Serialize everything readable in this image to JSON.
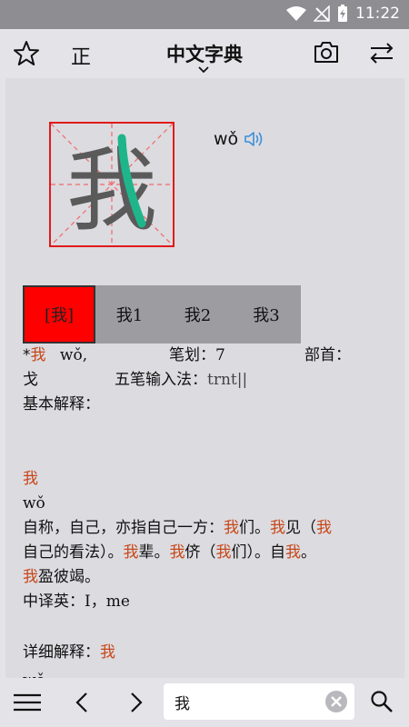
{
  "status": {
    "time": "11:22",
    "icons": [
      "wifi-icon",
      "no-signal-icon",
      "battery-charging-icon"
    ]
  },
  "topbar": {
    "zheng_label": "正",
    "title": "中文字典"
  },
  "char": {
    "glyph": "我",
    "pinyin": "wǒ"
  },
  "tabs": [
    {
      "label": "[我]"
    },
    {
      "label": "我1"
    },
    {
      "label": "我2"
    },
    {
      "label": "我3"
    }
  ],
  "entry": {
    "star": "*",
    "headword": "我",
    "pinyin": "wǒ,",
    "strokes_label": "笔划：",
    "strokes": "7",
    "radical_label": "部首：",
    "radical": "戈",
    "wubi_label": "五笔输入法：",
    "wubi": "trnt||",
    "basic_label": "基本解释："
  },
  "basic": {
    "char": "我",
    "pinyin": "wǒ",
    "line1": [
      {
        "t": "自称，自己，亦指自己一方：",
        "h": false
      },
      {
        "t": "我",
        "h": true
      },
      {
        "t": "们。",
        "h": false
      },
      {
        "t": "我",
        "h": true
      },
      {
        "t": "见（",
        "h": false
      },
      {
        "t": "我",
        "h": true
      }
    ],
    "line2": [
      {
        "t": "自己的看法）。",
        "h": false
      },
      {
        "t": "我",
        "h": true
      },
      {
        "t": "辈。",
        "h": false
      },
      {
        "t": "我",
        "h": true
      },
      {
        "t": "侪（",
        "h": false
      },
      {
        "t": "我",
        "h": true
      },
      {
        "t": "们）。自",
        "h": false
      },
      {
        "t": "我",
        "h": true
      },
      {
        "t": "。",
        "h": false
      }
    ],
    "line3": [
      {
        "t": "我",
        "h": true
      },
      {
        "t": "盈彼竭。",
        "h": false
      }
    ],
    "english_label": "中译英：",
    "english": "I，me"
  },
  "detail": {
    "label": "详细解释：",
    "char": "我",
    "cutoff_pinyin": "wǒ"
  },
  "search": {
    "value": "我"
  },
  "colors": {
    "accent": "#ff0000",
    "highlight": "#c8471a",
    "stroke_green": "#1fb58a",
    "speaker_blue": "#3a8fd8"
  }
}
